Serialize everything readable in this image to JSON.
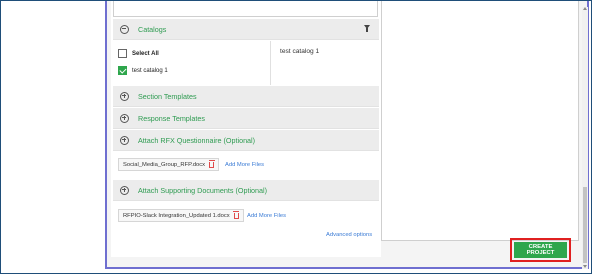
{
  "catalogs": {
    "title": "Catalogs",
    "filter_icon": "filter-icon",
    "select_all_label": "Select All",
    "select_all_checked": false,
    "items": [
      {
        "label": "test catalog 1",
        "checked": true
      }
    ],
    "selected_list": [
      "test catalog 1"
    ]
  },
  "sections": {
    "section_templates": "Section Templates",
    "response_templates": "Response Templates",
    "attach_rfx": "Attach RFX Questionnaire (Optional)",
    "attach_supporting": "Attach Supporting Documents (Optional)"
  },
  "rfx_files": {
    "file_name": "Social_Media_Group_RFP.docx",
    "add_more": "Add More Files"
  },
  "supporting_files": {
    "file_name": "RFPIO-Slack Integration_Updated 1.docx",
    "add_more": "Add More Files"
  },
  "advanced_options": "Advanced options",
  "create_project_label": "CREATE PROJECT",
  "colors": {
    "accent_green": "#2ea64c",
    "link_blue": "#3a7bd5",
    "highlight_red": "#e02020"
  }
}
